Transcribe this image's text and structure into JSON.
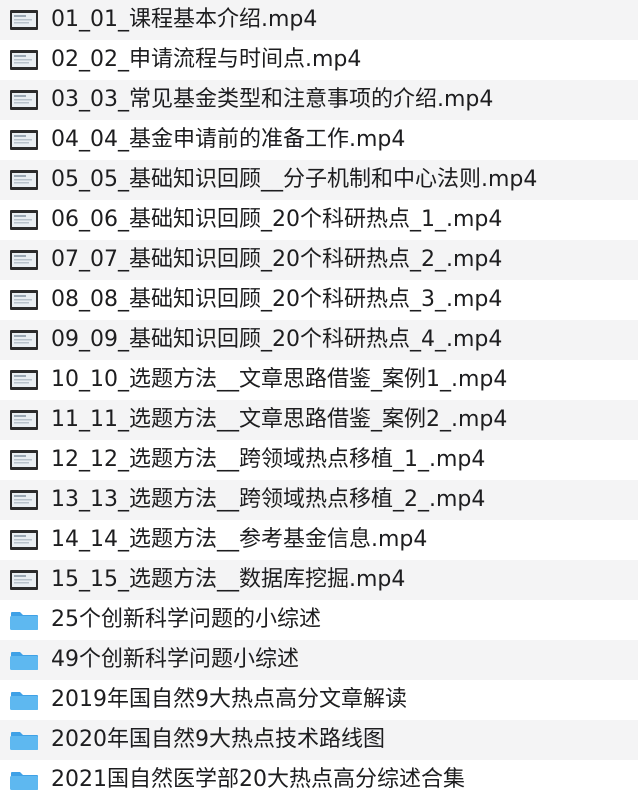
{
  "files": [
    {
      "name": "01_01_课程基本介绍.mp4",
      "type": "video",
      "icon": "video-thumbnail-icon"
    },
    {
      "name": "02_02_申请流程与时间点.mp4",
      "type": "video",
      "icon": "video-thumbnail-icon"
    },
    {
      "name": "03_03_常见基金类型和注意事项的介绍.mp4",
      "type": "video",
      "icon": "video-thumbnail-icon"
    },
    {
      "name": "04_04_基金申请前的准备工作.mp4",
      "type": "video",
      "icon": "video-thumbnail-icon"
    },
    {
      "name": "05_05_基础知识回顾__分子机制和中心法则.mp4",
      "type": "video",
      "icon": "video-thumbnail-icon"
    },
    {
      "name": "06_06_基础知识回顾_20个科研热点_1_.mp4",
      "type": "video",
      "icon": "video-thumbnail-icon"
    },
    {
      "name": "07_07_基础知识回顾_20个科研热点_2_.mp4",
      "type": "video",
      "icon": "video-thumbnail-icon"
    },
    {
      "name": "08_08_基础知识回顾_20个科研热点_3_.mp4",
      "type": "video",
      "icon": "video-thumbnail-icon"
    },
    {
      "name": "09_09_基础知识回顾_20个科研热点_4_.mp4",
      "type": "video",
      "icon": "video-thumbnail-icon"
    },
    {
      "name": "10_10_选题方法__文章思路借鉴_案例1_.mp4",
      "type": "video",
      "icon": "video-thumbnail-icon"
    },
    {
      "name": "11_11_选题方法__文章思路借鉴_案例2_.mp4",
      "type": "video",
      "icon": "video-thumbnail-icon"
    },
    {
      "name": "12_12_选题方法__跨领域热点移植_1_.mp4",
      "type": "video",
      "icon": "video-thumbnail-icon"
    },
    {
      "name": "13_13_选题方法__跨领域热点移植_2_.mp4",
      "type": "video",
      "icon": "video-thumbnail-icon"
    },
    {
      "name": "14_14_选题方法__参考基金信息.mp4",
      "type": "video",
      "icon": "video-thumbnail-icon"
    },
    {
      "name": "15_15_选题方法__数据库挖掘.mp4",
      "type": "video",
      "icon": "video-thumbnail-icon"
    },
    {
      "name": "25个创新科学问题的小综述",
      "type": "folder",
      "icon": "folder-icon"
    },
    {
      "name": "49个创新科学问题小综述",
      "type": "folder",
      "icon": "folder-icon"
    },
    {
      "name": "2019年国自然9大热点高分文章解读",
      "type": "folder",
      "icon": "folder-icon"
    },
    {
      "name": "2020年国自然9大热点技术路线图",
      "type": "folder",
      "icon": "folder-icon"
    },
    {
      "name": "2021国自然医学部20大热点高分综述合集",
      "type": "folder",
      "icon": "folder-icon"
    }
  ],
  "colors": {
    "row_alt": "#f4f4f5",
    "text": "#1d1d1f",
    "folder_body": "#5eb8f0",
    "folder_tab": "#3fa1e6",
    "thumb_frame": "#2b2b2b",
    "thumb_screen": "#e9eef2"
  }
}
